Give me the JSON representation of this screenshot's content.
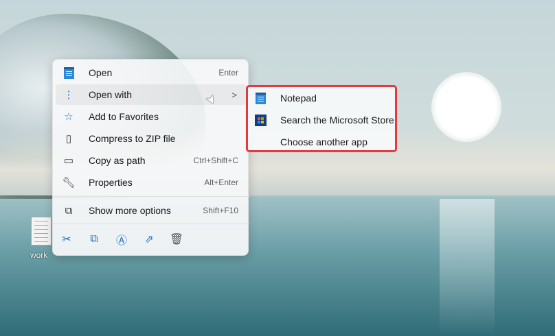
{
  "desktop": {
    "file_label": "work"
  },
  "menu": {
    "items": [
      {
        "label": "Open",
        "shortcut": "Enter",
        "icon": "notepad-icon"
      },
      {
        "label": "Open with",
        "shortcut": "",
        "icon": "open-with-icon",
        "chevron": ">"
      },
      {
        "label": "Add to Favorites",
        "shortcut": "",
        "icon": "star-icon"
      },
      {
        "label": "Compress to ZIP file",
        "shortcut": "",
        "icon": "zip-folder-icon"
      },
      {
        "label": "Copy as path",
        "shortcut": "Ctrl+Shift+C",
        "icon": "copy-path-icon"
      },
      {
        "label": "Properties",
        "shortcut": "Alt+Enter",
        "icon": "wrench-icon"
      },
      {
        "label": "Show more options",
        "shortcut": "Shift+F10",
        "icon": "show-more-icon"
      }
    ],
    "toolbar": [
      "cut-icon",
      "copy-icon",
      "rename-icon",
      "share-icon",
      "delete-icon"
    ]
  },
  "submenu": {
    "items": [
      {
        "label": "Notepad"
      },
      {
        "label": "Search the Microsoft Store"
      },
      {
        "label": "Choose another app"
      }
    ],
    "highlight_color": "#e53940"
  }
}
